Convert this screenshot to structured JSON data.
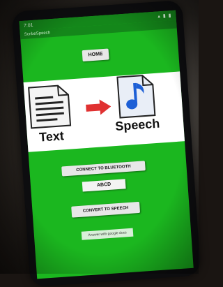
{
  "status_bar": {
    "time": "7:01",
    "icons": "▴ ▮ ▮"
  },
  "app_bar": {
    "title": "ScribeSpeech"
  },
  "buttons": {
    "home": "HOME",
    "connect_bluetooth": "CONNECT TO BLUETOOTH",
    "convert_speech": "CONVERT TO SPEECH"
  },
  "banner": {
    "left_label": "Text",
    "right_label": "Speech"
  },
  "input_field": {
    "value": "ABCD"
  },
  "hint_text": "Answer with google docs",
  "icons": [
    "document-icon",
    "right-arrow-icon",
    "music-note-icon"
  ],
  "colors": {
    "screen_bg": "#1bb71f",
    "app_bar": "#14871a",
    "arrow": "#e03131",
    "note": "#1d5fd6"
  }
}
